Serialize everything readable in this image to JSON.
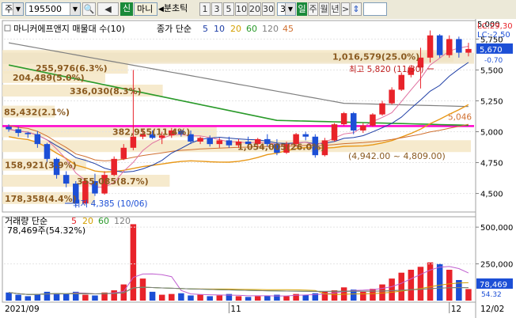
{
  "toolbar": {
    "market": "주",
    "code": "195500",
    "sin_label": "신",
    "stock_name": "마니",
    "timeframe": "분초틱",
    "periods": [
      "1",
      "3",
      "5",
      "10",
      "20",
      "30"
    ],
    "count": "3",
    "unit": "일",
    "views": [
      "주",
      "월",
      "년"
    ]
  },
  "colors": {
    "up": "#e8232a",
    "down": "#1c4fd6",
    "ma5": "#1f3fa6",
    "ma10": "#e89818",
    "ma20": "#2a9a2a",
    "ma60": "#e070a0",
    "ma120": "#808080",
    "ma45": "#d07030",
    "pink": "#ff00cc",
    "label": "#8a5a20"
  },
  "chart_data": [
    {
      "type": "candlestick",
      "title": "마니커에프앤지 매물대 수(10)",
      "legend_prefix": "종가 단순",
      "legend": [
        "5",
        "10",
        "20",
        "60",
        "120",
        "45"
      ],
      "yticks": [
        "5,000",
        "5,750",
        "5,500",
        "5,250",
        "5,000",
        "4,750",
        "4,500"
      ],
      "ylim": [
        4350,
        5900
      ],
      "ref_line": 5046,
      "ref_label": "5,046",
      "last_price": "5,670",
      "last_change": "-0.70",
      "lc_lines": [
        "LC:29,30",
        "LC:-2,50"
      ],
      "annotations": {
        "high": "최고 5,820 (11/30)",
        "low": "최저 4,385 (10/06)",
        "band": "(4,942.00 ~ 4,809.00)"
      },
      "volume_profile": [
        {
          "label": "1,016,579(25.0%)",
          "value": 5610
        },
        {
          "label": "255,976(6.3%)",
          "value": 5515
        },
        {
          "label": "204,489(5.0%)",
          "value": 5440
        },
        {
          "label": "336,030(8.3%)",
          "value": 5330
        },
        {
          "label": "85,432(2.1%)",
          "value": 5160
        },
        {
          "label": "382,955(11.4%)",
          "value": 5000
        },
        {
          "label": "1,054,005(26.0%)",
          "value": 4880
        },
        {
          "label": "158,921(3.9%)",
          "value": 4730
        },
        {
          "label": "355,085(8.7%)",
          "value": 4600
        },
        {
          "label": "178,358(4.4%)",
          "value": 4460
        }
      ],
      "ohlc": [
        [
          5040,
          5060,
          5000,
          5020
        ],
        [
          5020,
          5040,
          4960,
          4990
        ],
        [
          4990,
          5000,
          4950,
          4980
        ],
        [
          4980,
          5005,
          4870,
          4900
        ],
        [
          4900,
          4910,
          4750,
          4780
        ],
        [
          4780,
          4790,
          4620,
          4650
        ],
        [
          4650,
          4680,
          4550,
          4580
        ],
        [
          4580,
          4600,
          4385,
          4420
        ],
        [
          4420,
          4620,
          4410,
          4600
        ],
        [
          4600,
          4660,
          4480,
          4500
        ],
        [
          4500,
          4680,
          4490,
          4650
        ],
        [
          4650,
          4800,
          4640,
          4780
        ],
        [
          4780,
          4900,
          4770,
          4870
        ],
        [
          4870,
          5500,
          4850,
          4960
        ],
        [
          4960,
          5020,
          4940,
          4980
        ],
        [
          4980,
          5010,
          4940,
          4950
        ],
        [
          4950,
          5000,
          4900,
          4970
        ],
        [
          4970,
          5030,
          4950,
          5010
        ],
        [
          5010,
          5020,
          4960,
          4980
        ],
        [
          4980,
          5010,
          4900,
          4920
        ],
        [
          4920,
          4960,
          4900,
          4950
        ],
        [
          4950,
          4970,
          4880,
          4900
        ],
        [
          4900,
          4950,
          4870,
          4930
        ],
        [
          4930,
          4960,
          4870,
          4890
        ],
        [
          4890,
          4940,
          4870,
          4920
        ],
        [
          4920,
          4960,
          4880,
          4900
        ],
        [
          4900,
          4950,
          4880,
          4940
        ],
        [
          4940,
          4980,
          4880,
          4900
        ],
        [
          4900,
          4940,
          4810,
          4830
        ],
        [
          4830,
          4920,
          4820,
          4900
        ],
        [
          4900,
          4990,
          4880,
          4980
        ],
        [
          4980,
          5000,
          4930,
          4960
        ],
        [
          4960,
          4980,
          4790,
          4810
        ],
        [
          4810,
          4950,
          4800,
          4930
        ],
        [
          4930,
          5070,
          4920,
          5060
        ],
        [
          5060,
          5160,
          5050,
          5150
        ],
        [
          5150,
          5160,
          4980,
          5010
        ],
        [
          5010,
          5070,
          4990,
          5050
        ],
        [
          5050,
          5150,
          5040,
          5140
        ],
        [
          5140,
          5250,
          5130,
          5230
        ],
        [
          5230,
          5360,
          5220,
          5340
        ],
        [
          5340,
          5480,
          5330,
          5460
        ],
        [
          5460,
          5540,
          5440,
          5520
        ],
        [
          5520,
          5680,
          5350,
          5600
        ],
        [
          5600,
          5820,
          5560,
          5780
        ],
        [
          5780,
          5790,
          5600,
          5620
        ],
        [
          5620,
          5780,
          5600,
          5750
        ],
        [
          5750,
          5770,
          5600,
          5640
        ],
        [
          5640,
          5720,
          5610,
          5670
        ]
      ],
      "volume_legend": "거래량 단순",
      "volume_legend_values": [
        "5",
        "20",
        "60",
        "120"
      ],
      "volume_info": "78,469주(54.32%)",
      "volume_yticks": [
        "500,000",
        "250,000"
      ],
      "volume_ylim": [
        0,
        560000
      ],
      "volume_last": "78,469",
      "volume_last_pct": "54.32",
      "volume": [
        55000,
        40000,
        30000,
        45000,
        60000,
        50000,
        45000,
        60000,
        40000,
        35000,
        55000,
        70000,
        110000,
        520000,
        150000,
        60000,
        40000,
        45000,
        50000,
        35000,
        40000,
        30000,
        35000,
        45000,
        30000,
        25000,
        30000,
        35000,
        40000,
        30000,
        45000,
        40000,
        50000,
        60000,
        70000,
        90000,
        75000,
        60000,
        80000,
        110000,
        150000,
        190000,
        210000,
        230000,
        260000,
        250000,
        210000,
        140000,
        78469
      ],
      "xlabels": [
        "2021/09",
        "11",
        "12",
        "12/02"
      ]
    }
  ]
}
